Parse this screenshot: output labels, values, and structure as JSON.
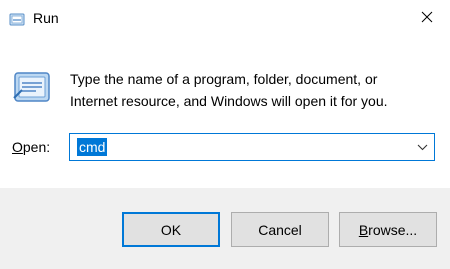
{
  "window": {
    "title": "Run",
    "close_icon": "close-icon",
    "app_icon": "run-icon"
  },
  "description": {
    "line1": "Type the name of a program, folder, document, or",
    "line2": "Internet resource, and Windows will open it for you."
  },
  "open_field": {
    "label_underlined": "O",
    "label_rest": "pen:",
    "value": "cmd"
  },
  "buttons": {
    "ok": "OK",
    "cancel": "Cancel",
    "browse_underlined": "B",
    "browse_rest": "rowse..."
  },
  "colors": {
    "accent": "#0078d7",
    "footer_bg": "#f0f0f0",
    "button_bg": "#e1e1e1"
  }
}
